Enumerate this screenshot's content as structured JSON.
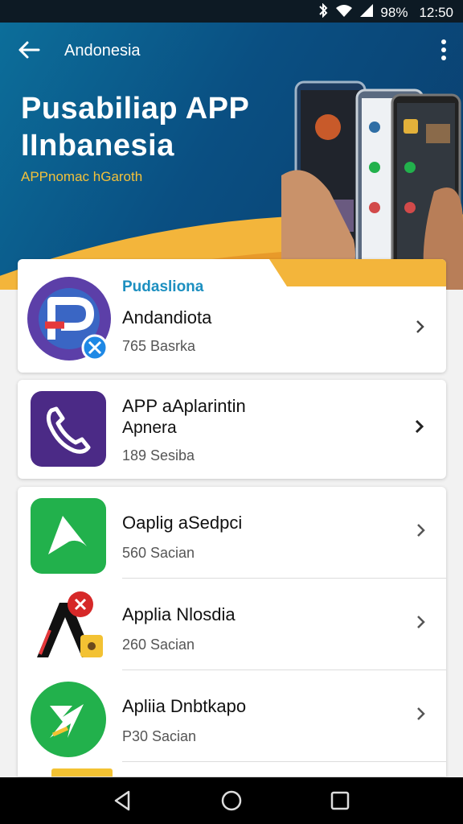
{
  "status": {
    "battery": "98%",
    "time": "12:50"
  },
  "topbar": {
    "title": "Andonesia"
  },
  "hero": {
    "title": "Pusabiliap APP\nIInbanesia",
    "subtitle": "APPnomac hGaroth"
  },
  "featured": {
    "label": "Pudasliona",
    "name": "Andandiota",
    "meta": "765 Basrka"
  },
  "apps": [
    {
      "name": "APP aAplarintin",
      "sub": "Apnera",
      "meta": "189 Sesiba"
    },
    {
      "name": "Oaplig aSedpci",
      "meta": "560 Sacian"
    },
    {
      "name": "Applia Nlosdia",
      "meta": "260 Sacian"
    },
    {
      "name": "Apliia Dnbtkapo",
      "meta": "P30 Sacian"
    }
  ],
  "colors": {
    "accent_yellow": "#f2c13b",
    "brand_blue": "#0a4f82",
    "viber_purple": "#4b2a86",
    "green": "#22b14c"
  }
}
